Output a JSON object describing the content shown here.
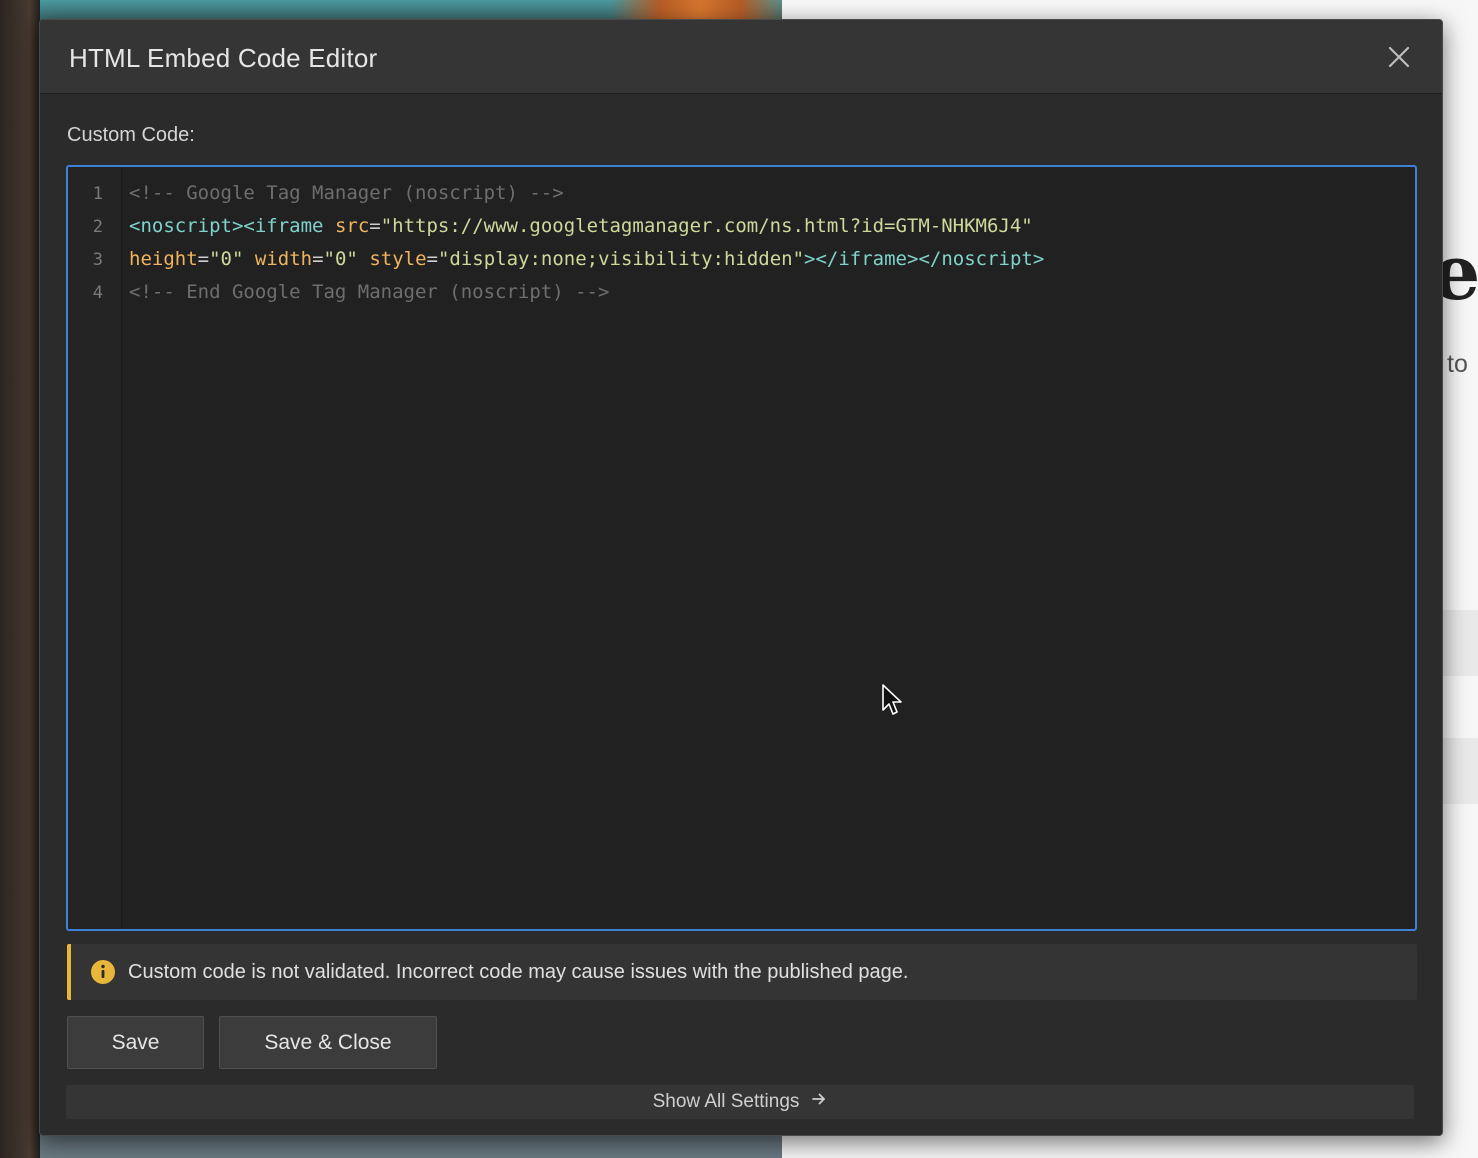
{
  "background": {
    "heading_fragment": "er",
    "text_fragment": "to"
  },
  "modal": {
    "title": "HTML Embed Code Editor",
    "close_icon": "close-icon",
    "field_label": "Custom Code:",
    "code_lines": [
      {
        "number": "1",
        "text": "<!-- Google Tag Manager (noscript) -->"
      },
      {
        "number": "2",
        "text": "<noscript><iframe src=\"https://www.googletagmanager.com/ns.html?id=GTM-NHKM6J4\""
      },
      {
        "number": "3",
        "text": "height=\"0\" width=\"0\" style=\"display:none;visibility:hidden\"></iframe></noscript>"
      },
      {
        "number": "4",
        "text": "<!-- End Google Tag Manager (noscript) -->"
      }
    ],
    "warning": {
      "icon": "info-icon",
      "text": "Custom code is not validated. Incorrect code may cause issues with the published page.",
      "accent_color": "#e8b63a"
    },
    "buttons": {
      "save": "Save",
      "save_close": "Save & Close"
    },
    "show_all_settings": "Show All Settings",
    "arrow_icon": "arrow-right-icon"
  },
  "colors": {
    "editor_focus_border": "#3f7fd6",
    "modal_bg": "#2b2b2c"
  }
}
